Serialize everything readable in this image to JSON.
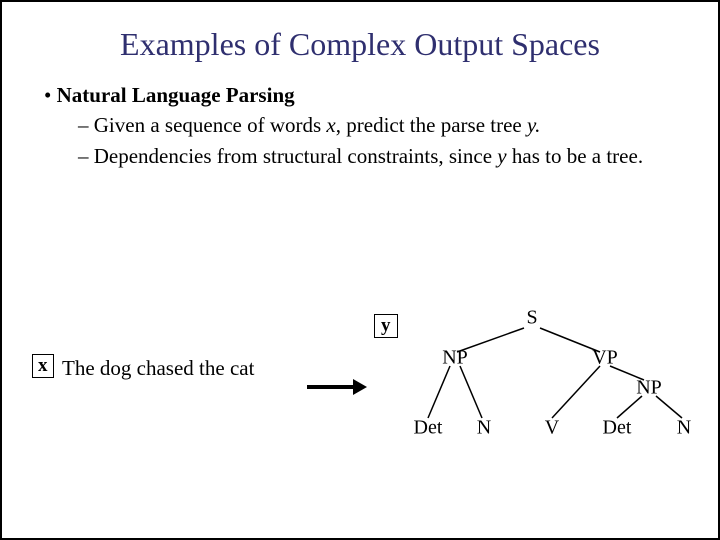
{
  "title": "Examples of Complex Output Spaces",
  "bullets": {
    "main": "Natural Language Parsing",
    "sub1_a": "Given a sequence of words ",
    "sub1_x": "x",
    "sub1_b": ", predict the parse tree ",
    "sub1_y": "y.",
    "sub2_a": "Dependencies from structural constraints, since ",
    "sub2_y": "y",
    "sub2_b": " has to be a tree."
  },
  "example": {
    "x_label": "x",
    "x_text": "The dog chased the cat",
    "y_label": "y"
  },
  "tree": {
    "S": "S",
    "NP1": "NP",
    "VP": "VP",
    "NP2": "NP",
    "Det1": "Det",
    "N1": "N",
    "V": "V",
    "Det2": "Det",
    "N2": "N"
  }
}
